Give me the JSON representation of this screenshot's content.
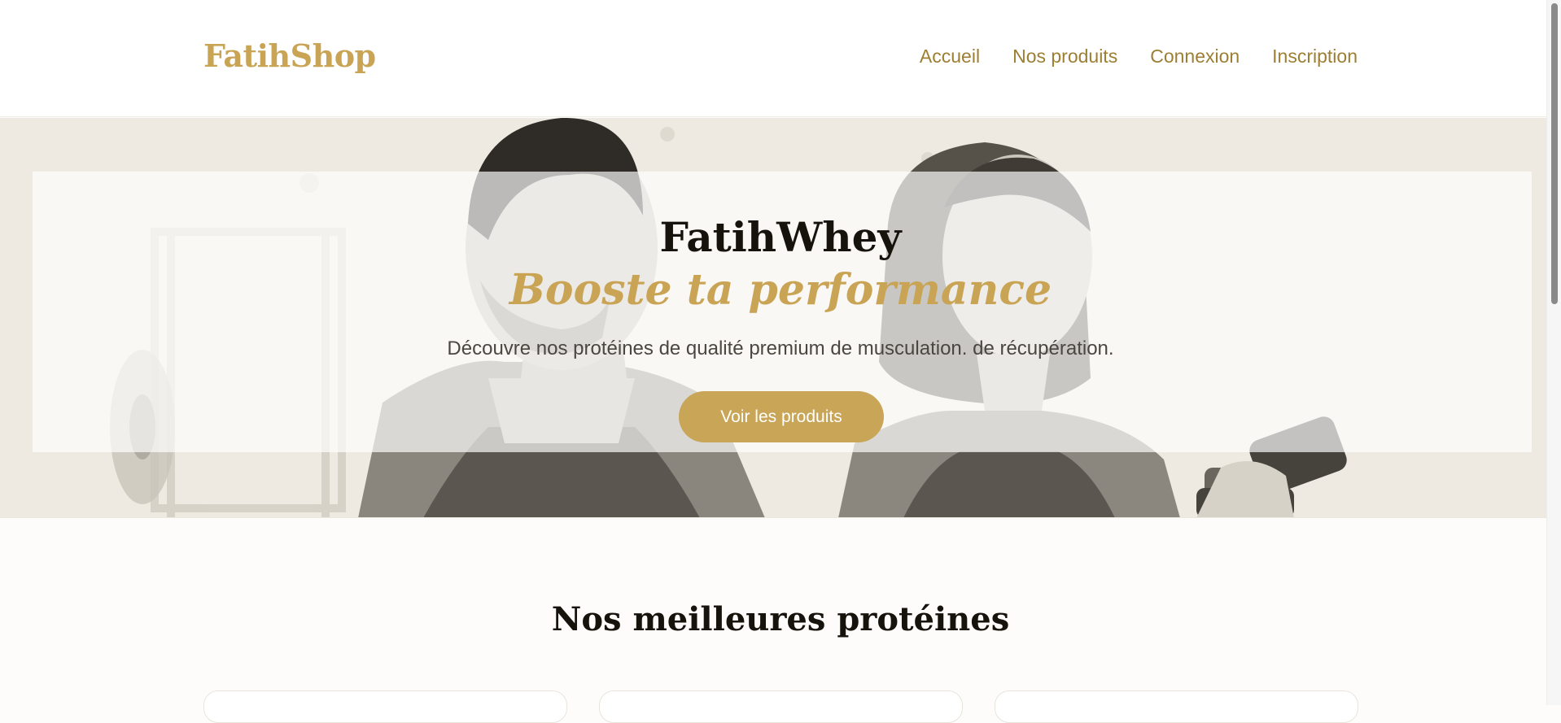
{
  "header": {
    "logo": "FatihShop",
    "nav": [
      "Accueil",
      "Nos produits",
      "Connexion",
      "Inscription"
    ]
  },
  "hero": {
    "title": "FatihWhey",
    "subtitle": "Booste ta performance",
    "description": "Découvre nos protéines de qualité premium de musculation. de récupération.",
    "cta": "Voir les produits",
    "image": "illustration-man-and-woman-gym"
  },
  "section": {
    "title": "Nos meilleures protéines"
  },
  "colors": {
    "accent": "#c9a455",
    "nav_text": "#9c7f33",
    "button": "#c8a557",
    "heading": "#16120c"
  }
}
